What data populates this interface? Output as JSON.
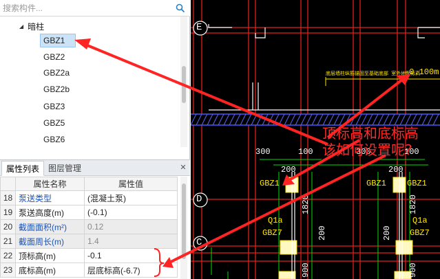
{
  "search": {
    "placeholder": "搜索构件..."
  },
  "tree": {
    "parent_label": "暗柱",
    "items": [
      "GBZ1",
      "GBZ2",
      "GBZ2a",
      "GBZ2b",
      "GBZ3",
      "GBZ5",
      "GBZ6"
    ],
    "selected_index": 0
  },
  "tabs": {
    "properties": "属性列表",
    "layers": "图层管理"
  },
  "prop_table": {
    "headers": [
      "属性名称",
      "属性值"
    ],
    "rows": [
      {
        "num": "18",
        "name": "泵送类型",
        "value": "(混凝土泵)"
      },
      {
        "num": "19",
        "name": "泵送高度(m)",
        "value": "(-0.1)"
      },
      {
        "num": "20",
        "name": "截面面积(m²)",
        "value": "0.12"
      },
      {
        "num": "21",
        "name": "截面周长(m)",
        "value": "1.4"
      },
      {
        "num": "22",
        "name": "顶标高(m)",
        "value": "-0.1"
      },
      {
        "num": "23",
        "name": "底标高(m)",
        "value": "层底标高(-6.7)"
      }
    ]
  },
  "cad": {
    "grid_labels": [
      "E",
      "D",
      "C"
    ],
    "elevation_note": "底层墙柱纵筋锚固至基础底部 室外地面标高",
    "elevation_value": "-0.100m",
    "dims": [
      "300",
      "100",
      "300",
      "100",
      "200",
      "200",
      "1820",
      "1820",
      "200",
      "200",
      "900",
      "900"
    ],
    "labels": [
      "GBZ1",
      "GBZ1",
      "GBZ1",
      "Q1a",
      "Q1a",
      "GBZ7",
      "GBZ7"
    ]
  },
  "annotation": {
    "line1": "顶标高和底标高",
    "line2": "该如何设置呢?"
  },
  "colors": {
    "selection": "#cce2f7",
    "annotation": "#ff2a2a",
    "cad_bg": "#000000"
  }
}
